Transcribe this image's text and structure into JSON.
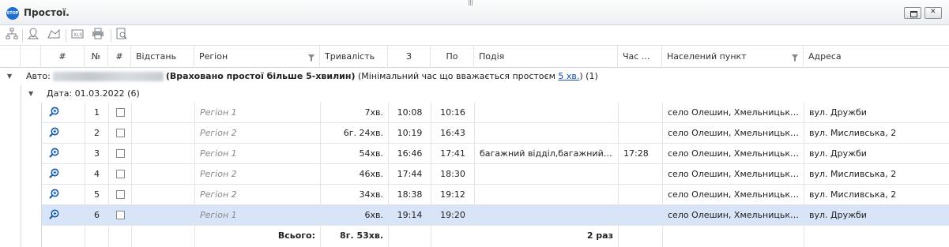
{
  "window": {
    "icon_label": "STOP",
    "title": "Простої."
  },
  "toolbar": {
    "icons": [
      "hierarchy-icon",
      "map-pin-icon",
      "map-area-icon",
      "export-icon",
      "print-icon",
      "preview-icon"
    ]
  },
  "columns": [
    "#",
    "№",
    "#",
    "Відстань",
    "Регіон",
    "Тривалість",
    "З",
    "По",
    "Подія",
    "Час ...",
    "Населений пункт",
    "Адреса"
  ],
  "group_auto": {
    "prefix": "Авто:",
    "bold_text": "(Враховано простої більше 5-хвилин)",
    "note": "(Мінімальний час що вважається простоєм",
    "link": "5 хв.",
    "note_end": ")",
    "count": "(1)"
  },
  "group_date": {
    "label": "Дата: 01.03.2022 (6)"
  },
  "rows": [
    {
      "num": "1",
      "distance": "",
      "region": "Регіон 1",
      "duration": "7хв.",
      "from": "10:08",
      "to": "10:16",
      "event": "",
      "time": "",
      "settlement": "село Олешин, Хмельницька...",
      "address": "вул. Дружби"
    },
    {
      "num": "2",
      "distance": "",
      "region": "Регіон 2",
      "duration": "6г. 24хв.",
      "from": "10:19",
      "to": "16:43",
      "event": "",
      "time": "",
      "settlement": "село Олешин, Хмельницька...",
      "address": "вул. Мисливська, 2"
    },
    {
      "num": "3",
      "distance": "",
      "region": "Регіон 1",
      "duration": "54хв.",
      "from": "16:46",
      "to": "17:41",
      "event": "багажний відділ,багажний ...",
      "time": "17:28",
      "settlement": "село Олешин, Хмельницька...",
      "address": "вул. Дружби"
    },
    {
      "num": "4",
      "distance": "",
      "region": "Регіон 2",
      "duration": "46хв.",
      "from": "17:44",
      "to": "18:30",
      "event": "",
      "time": "",
      "settlement": "село Олешин, Хмельницька...",
      "address": "вул. Мисливська, 2"
    },
    {
      "num": "5",
      "distance": "",
      "region": "Регіон 2",
      "duration": "34хв.",
      "from": "18:38",
      "to": "19:12",
      "event": "",
      "time": "",
      "settlement": "село Олешин, Хмельницька...",
      "address": "вул. Мисливська, 2"
    },
    {
      "num": "6",
      "distance": "",
      "region": "Регіон 1",
      "duration": "6хв.",
      "from": "19:14",
      "to": "19:20",
      "event": "",
      "time": "",
      "settlement": "село Олешин, Хмельницька...",
      "address": "вул. Дружби",
      "selected": true
    }
  ],
  "totals": {
    "label": "Всього:",
    "duration": "8г. 53хв.",
    "count": "2 раз"
  }
}
